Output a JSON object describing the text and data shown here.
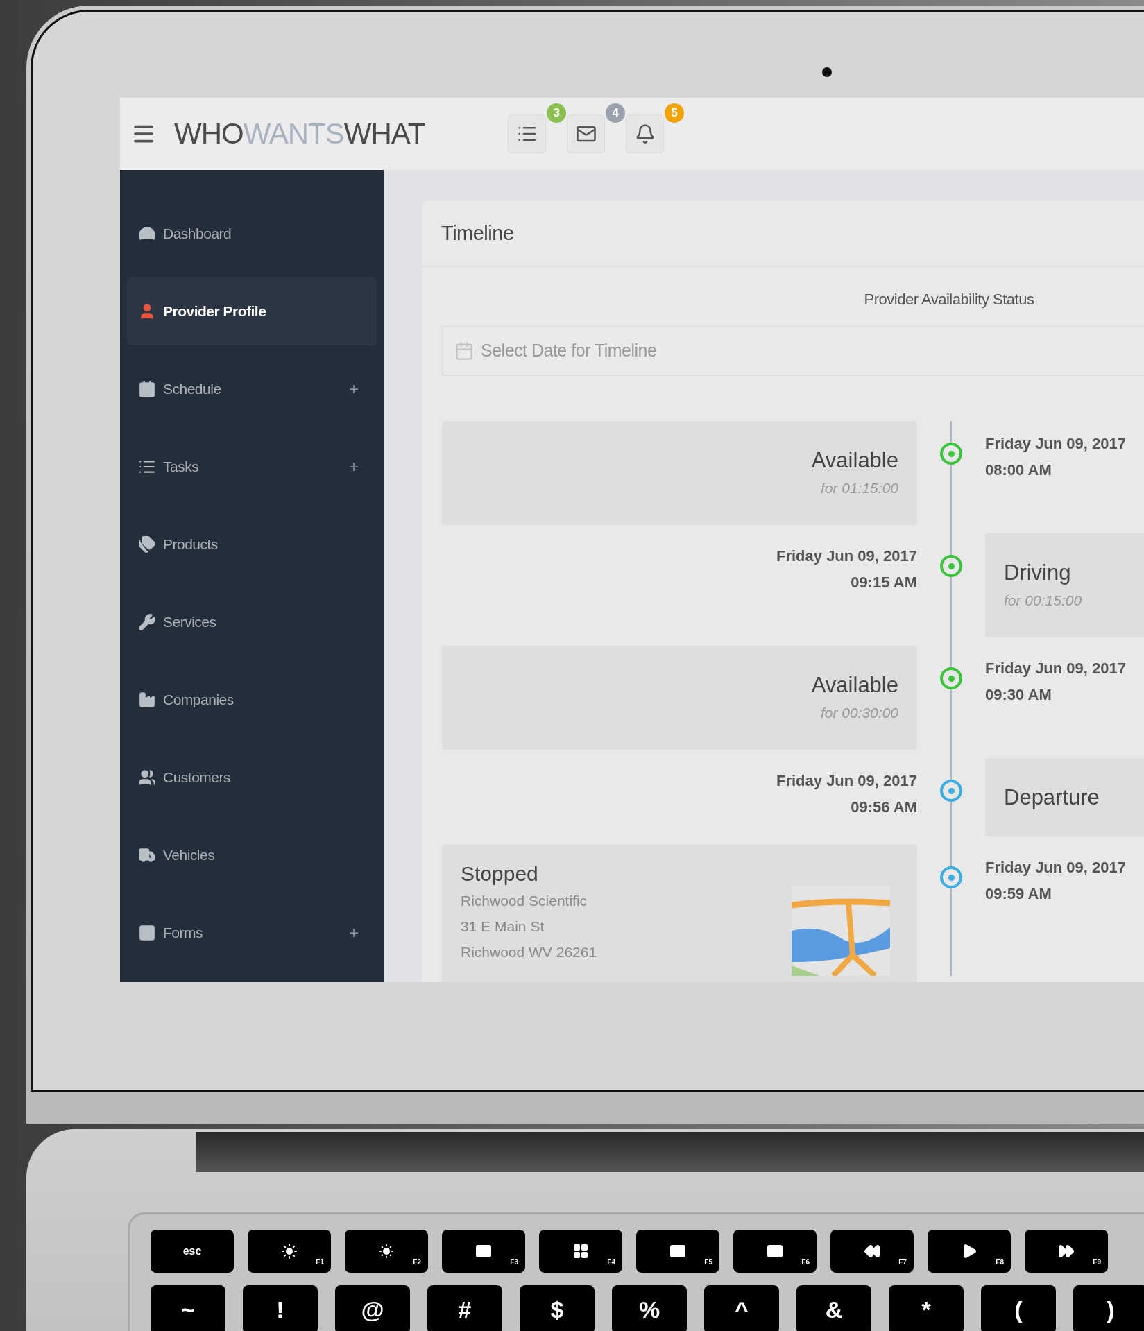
{
  "header": {
    "logo": [
      {
        "text": "WHO",
        "muted": false
      },
      {
        "text": "WANTS",
        "muted": true
      },
      {
        "text": "WHAT",
        "muted": false
      }
    ],
    "icon_buttons": [
      {
        "badge": "3",
        "color": "#8cc152"
      },
      {
        "badge": "4",
        "color": "#9aa3ad"
      },
      {
        "badge": "5",
        "color": "#f0a30a"
      }
    ]
  },
  "sidebar": {
    "items": [
      {
        "label": "Dashboard",
        "selected": false
      },
      {
        "label": "Provider Profile",
        "selected": true
      },
      {
        "label": "Schedule",
        "selected": false,
        "toggle": "+"
      },
      {
        "label": "Tasks",
        "selected": false,
        "toggle": "+"
      },
      {
        "label": "Products",
        "selected": false
      },
      {
        "label": "Services",
        "selected": false
      },
      {
        "label": "Companies",
        "selected": false
      },
      {
        "label": "Customers",
        "selected": false
      },
      {
        "label": "Vehicles",
        "selected": false
      },
      {
        "label": "Forms",
        "selected": false,
        "toggle": "+"
      }
    ]
  },
  "timeline": {
    "title": "Timeline",
    "subtitle": "Provider Availability Status",
    "date_field": {
      "placeholder": "Select Date for Timeline"
    },
    "events": [
      {
        "kind": "left",
        "status": "Available",
        "duration": "for 01:15:00",
        "date": "Friday Jun 09, 2017",
        "time": "08:00 AM",
        "color": "#3cc43c"
      },
      {
        "kind": "right",
        "status": "Driving",
        "duration": "for 00:15:00",
        "date": "Friday Jun 09, 2017",
        "time": "09:15 AM",
        "color": "#3cc43c"
      },
      {
        "kind": "left",
        "status": "Available",
        "duration": "for 00:30:00",
        "date": "Friday Jun 09, 2017",
        "time": "09:30 AM",
        "color": "#3cc43c"
      },
      {
        "kind": "right",
        "status": "Departure",
        "date": "Friday Jun 09, 2017",
        "time": "09:56 AM",
        "color": "#3aaee0"
      },
      {
        "kind": "left",
        "status": "Stopped",
        "address": [
          "Richwood Scientific",
          "31 E Main St",
          "Richwood WV 26261"
        ],
        "date": "Friday Jun 09, 2017",
        "time": "09:59 AM",
        "color": "#3aaee0"
      }
    ]
  },
  "keyboard": {
    "function_row": [
      {
        "label": "esc"
      },
      {
        "label": "F1"
      },
      {
        "label": "F2"
      },
      {
        "label": "F3"
      },
      {
        "label": "F4"
      },
      {
        "label": "F5"
      },
      {
        "label": "F6"
      },
      {
        "label": "F7"
      },
      {
        "label": "F8"
      },
      {
        "label": "F9"
      }
    ],
    "symbol_row": [
      "~",
      "!",
      "@",
      "#",
      "$",
      "%",
      "^",
      "&",
      "*",
      "(",
      ")"
    ]
  }
}
